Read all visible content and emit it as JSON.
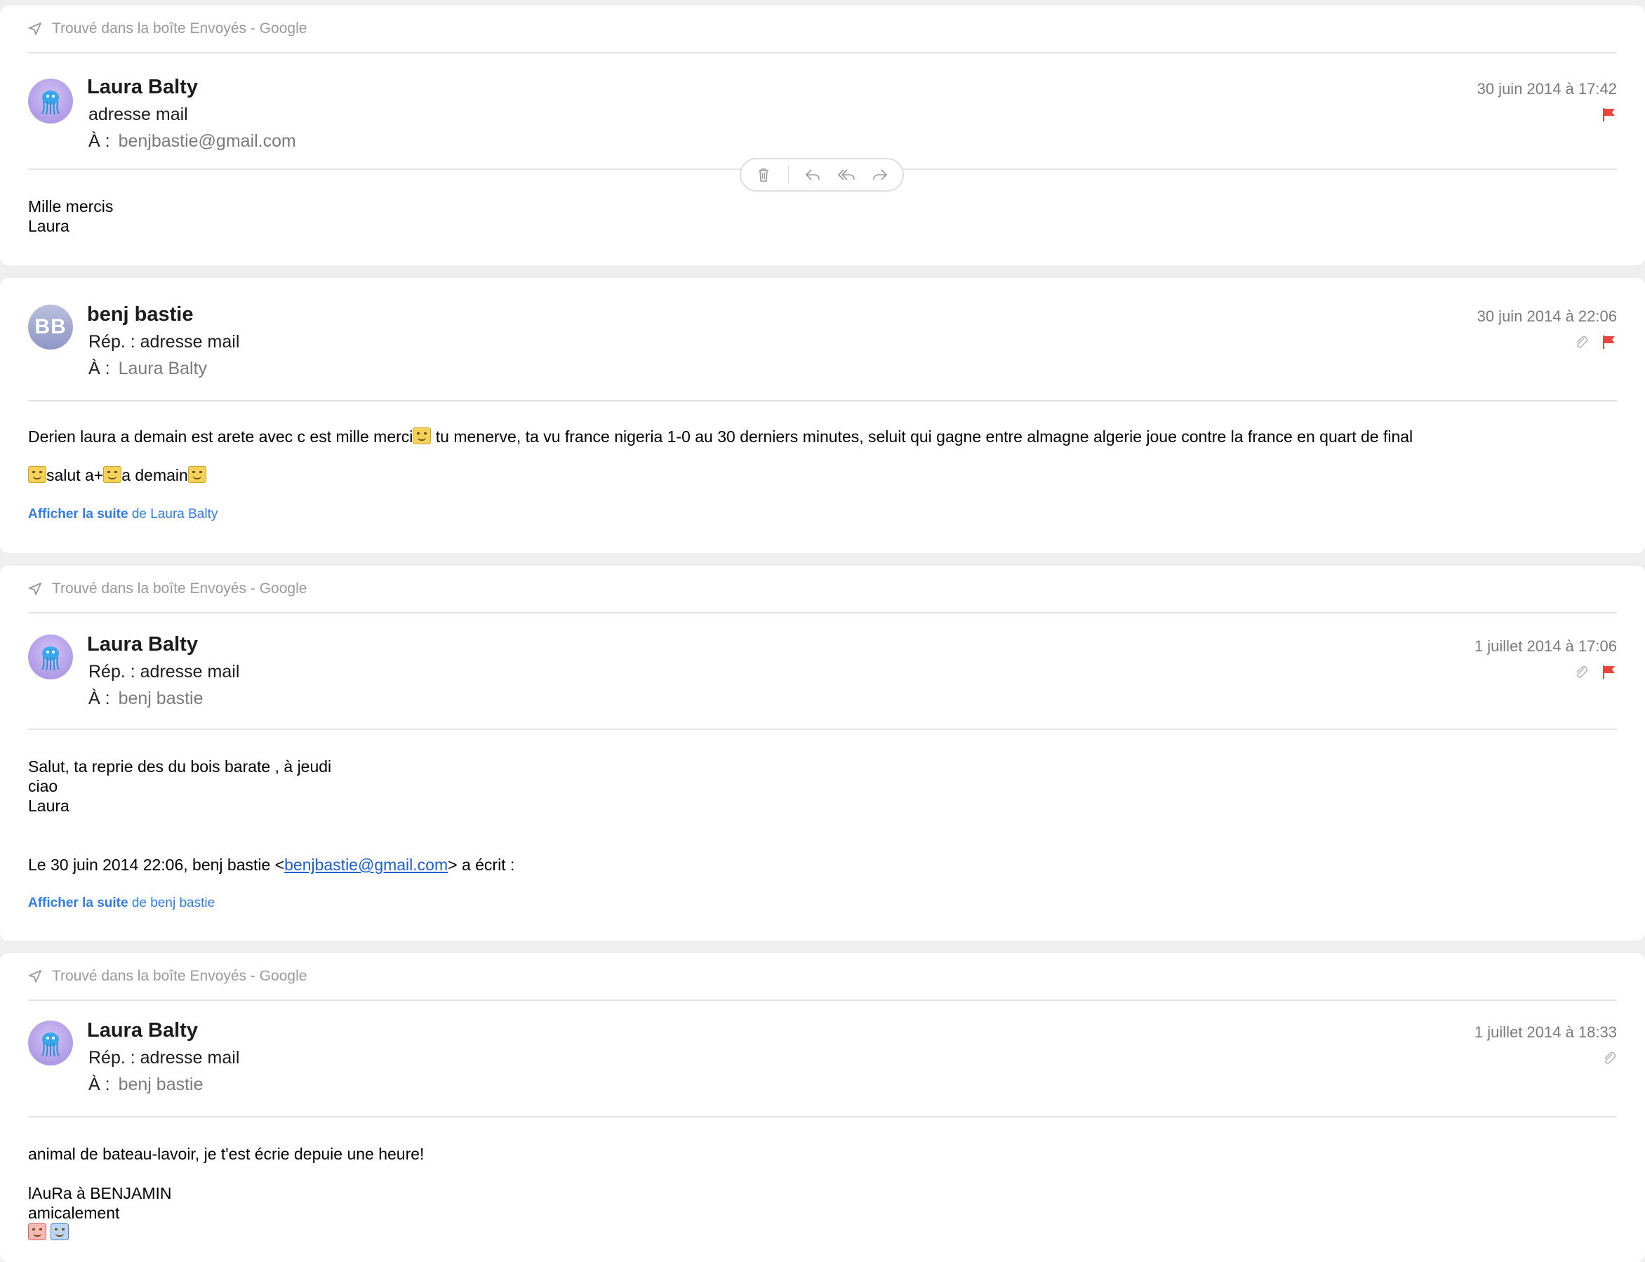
{
  "sent_note": "Trouvé dans la boîte Envoyés - Google",
  "messages": [
    {
      "sender": "Laura Balty",
      "subject": "adresse mail",
      "to_label": "À :",
      "to": "benjbastie@gmail.com",
      "date": "30 juin 2014 à 17:42",
      "body": [
        "Mille mercis",
        "Laura"
      ]
    },
    {
      "sender": "benj bastie",
      "avatar_initials": "BB",
      "subject": "Rép. : adresse mail",
      "to_label": "À :",
      "to": "Laura Balty",
      "date": "30 juin 2014 à 22:06",
      "body_line1_a": "Derien laura a demain est arete avec c est mille merci",
      "body_line1_b": " tu menerve, ta vu france nigeria 1-0 au 30 derniers minutes, seluit qui gagne entre almagne algerie joue contre la france en quart de final",
      "body_line2_a": "salut a+",
      "body_line2_b": "a demain",
      "show_more_bold": "Afficher la suite",
      "show_more_rest": " de Laura Balty"
    },
    {
      "sender": "Laura Balty",
      "subject": "Rép. : adresse mail",
      "to_label": "À :",
      "to": "benj bastie",
      "date": "1 juillet 2014 à 17:06",
      "body": [
        "Salut, ta reprie des du bois barate , à jeudi",
        "ciao",
        "Laura"
      ],
      "quote_prefix": "Le 30 juin 2014 22:06, benj bastie <",
      "quote_email": "benjbastie@gmail.com",
      "quote_suffix": "> a écrit :",
      "show_more_bold": "Afficher la suite",
      "show_more_rest": " de benj bastie"
    },
    {
      "sender": "Laura Balty",
      "subject": "Rép. : adresse mail",
      "to_label": "À :",
      "to": "benj bastie",
      "date": "1 juillet 2014 à 18:33",
      "body_line1": "animal de bateau-lavoir, je t'est écrie depuie une heure!",
      "body_line2": "lAuRa à BENJAMIN",
      "body_line3": "amicalement"
    }
  ],
  "colors": {
    "flag": "#e8453c",
    "link": "#2f7de1",
    "muted": "#7a7a7a"
  },
  "icons": {
    "sent": "paper-plane-icon",
    "flag": "red-flag-icon",
    "attachment": "paperclip-icon",
    "trash": "trash-icon",
    "reply": "reply-icon",
    "reply_all": "reply-all-icon",
    "forward": "forward-icon"
  }
}
